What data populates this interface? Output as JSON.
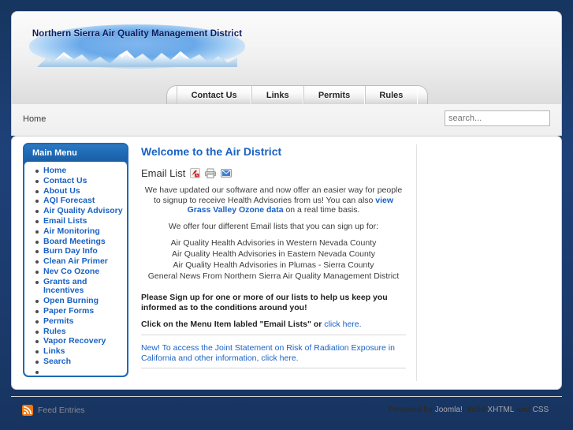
{
  "site": {
    "logo_title": "Northern Sierra Air Quality Management District",
    "logo_icon": "snowy-mountains-logo"
  },
  "nav": {
    "items": [
      {
        "label": "Contact Us"
      },
      {
        "label": "Links"
      },
      {
        "label": "Permits"
      },
      {
        "label": "Rules"
      }
    ]
  },
  "breadcrumb": {
    "text": "Home"
  },
  "search": {
    "placeholder": "search...",
    "value": ""
  },
  "sidebar": {
    "module_title": "Main Menu",
    "items": [
      {
        "label": "Home"
      },
      {
        "label": "Contact Us"
      },
      {
        "label": "About Us"
      },
      {
        "label": "AQI Forecast"
      },
      {
        "label": "Air Quality Advisory"
      },
      {
        "label": "Email Lists"
      },
      {
        "label": "Air Monitoring"
      },
      {
        "label": "Board Meetings"
      },
      {
        "label": "Burn Day Info"
      },
      {
        "label": "Clean Air Primer"
      },
      {
        "label": "Nev Co Ozone"
      },
      {
        "label": "Grants and Incentives"
      },
      {
        "label": "Open Burning"
      },
      {
        "label": "Paper Forms"
      },
      {
        "label": "Permits"
      },
      {
        "label": "Rules"
      },
      {
        "label": "Vapor Recovery"
      },
      {
        "label": "Links"
      },
      {
        "label": "Search"
      },
      {
        "label": ""
      }
    ]
  },
  "article": {
    "title": "Welcome to the Air District",
    "subtitle": "Email List",
    "icons": [
      {
        "name": "pdf-icon",
        "title": "PDF"
      },
      {
        "name": "print-icon",
        "title": "Print"
      },
      {
        "name": "email-icon",
        "title": "E-mail"
      }
    ],
    "intro_part1": "We have updated our software and now offer an easier way for people to signup to receive Health Advisories from us! You can also ",
    "intro_link": "view Grass Valley Ozone data",
    "intro_part2": " on a real time basis.",
    "offer_line": "We offer four different Email lists that you can sign up for:",
    "lists": [
      "Air Quality Health Advisories in Western Nevada County",
      "Air Quality Health Advisories in Eastern Nevada County",
      "Air Quality Health Advisories in Plumas - Sierra County",
      "General News From Northern Sierra Air Quality Management District"
    ],
    "signup_call": "Please Sign up for one or more of our lists to help us keep you informed as to the conditions around you!",
    "menu_instruction": "Click on the Menu Item labled \"Email Lists\" or ",
    "menu_instruction_link": "click here.",
    "radiation_note": "New! To access the Joint Statement on Risk of Radiation Exposure in California and other information, click here."
  },
  "footer": {
    "feed_label": "Feed Entries",
    "feed_icon": "rss-icon",
    "powered_by": "Powered by ",
    "joomla": "Joomla!",
    "joomla_suffix": ". ",
    "valid": "Valid ",
    "xhtml": "XHTML",
    "and": " and ",
    "css": "CSS",
    "period": "."
  },
  "colors": {
    "page_bg": "#1c3d70",
    "module_header": "#1f69b4",
    "link_blue": "#1a62c4",
    "rss_orange": "#ee7811",
    "logo_navy": "#0c1d5e"
  }
}
